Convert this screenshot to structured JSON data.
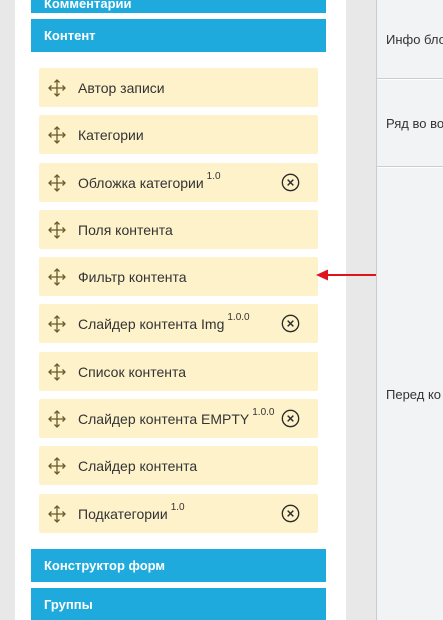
{
  "categories": {
    "top_cut": "Комментарии",
    "content": "Контент",
    "forms": "Конструктор форм",
    "groups": "Группы"
  },
  "content_items": [
    {
      "label": "Автор записи",
      "version": "",
      "removable": false
    },
    {
      "label": "Категории",
      "version": "",
      "removable": false
    },
    {
      "label": "Обложка категории",
      "version": "1.0",
      "removable": true
    },
    {
      "label": "Поля контента",
      "version": "",
      "removable": false
    },
    {
      "label": "Фильтр контента",
      "version": "",
      "removable": false
    },
    {
      "label": "Слайдер контента Img",
      "version": "1.0.0",
      "removable": true
    },
    {
      "label": "Список контента",
      "version": "",
      "removable": false
    },
    {
      "label": "Слайдер контента EMPTY",
      "version": "1.0.0",
      "removable": true
    },
    {
      "label": "Слайдер контента",
      "version": "",
      "removable": false
    },
    {
      "label": "Подкатегории",
      "version": "1.0",
      "removable": true
    }
  ],
  "right_panel": {
    "cells": [
      "Инфо бло",
      "Ряд во во",
      "Перед ко"
    ]
  },
  "colors": {
    "category_bar": "#1eaadd",
    "item_bg": "#fef2cb",
    "annotation_arrow": "#e0131c"
  },
  "icons": {
    "drag": "move-arrows-icon",
    "remove": "circle-x-icon"
  }
}
